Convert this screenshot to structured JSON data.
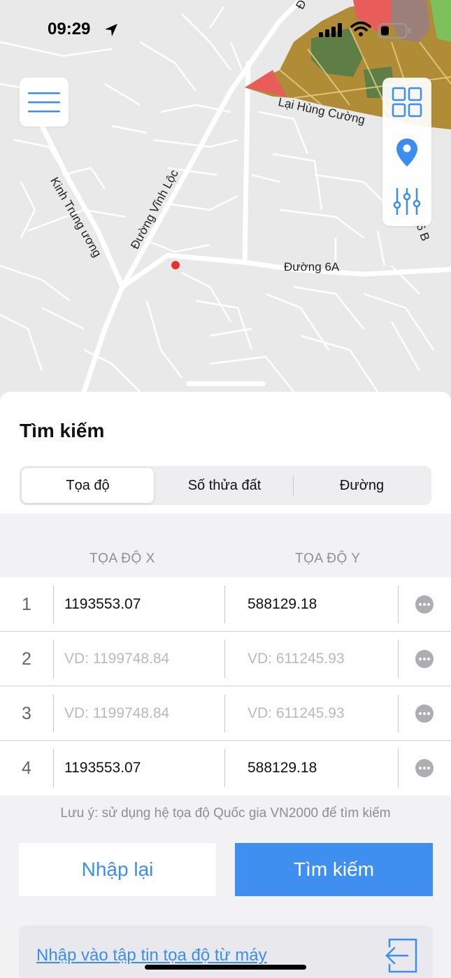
{
  "status_bar": {
    "time": "09:29"
  },
  "map": {
    "road_labels": [
      "Kinh Trung ương",
      "Đường Vĩnh Lộc",
      "Lại Hùng Cường",
      "Đường 6A",
      "6 B",
      "Đ"
    ],
    "colors": {
      "background": "#e9e9ea",
      "zone_ochre": "#b08c36",
      "zone_green": "#5f7e46",
      "zone_red": "#e85c5a",
      "marker": "#e8302a"
    }
  },
  "side_buttons": [
    "grid-icon",
    "location-pin-icon",
    "sliders-icon"
  ],
  "search": {
    "title": "Tìm kiếm",
    "tabs": [
      {
        "label": "Tọa độ",
        "active": true
      },
      {
        "label": "Số thửa đất",
        "active": false
      },
      {
        "label": "Đường",
        "active": false
      }
    ],
    "columns": {
      "x": "TỌA ĐỘ X",
      "y": "TỌA ĐỘ Y"
    },
    "rows": [
      {
        "index": "1",
        "x": "1193553.07",
        "y": "588129.18",
        "x_placeholder": "VD: 1199748.84",
        "y_placeholder": "VD: 611245.93"
      },
      {
        "index": "2",
        "x": "",
        "y": "",
        "x_placeholder": "VD: 1199748.84",
        "y_placeholder": "VD: 611245.93"
      },
      {
        "index": "3",
        "x": "",
        "y": "",
        "x_placeholder": "VD: 1199748.84",
        "y_placeholder": "VD: 611245.93"
      },
      {
        "index": "4",
        "x": "1193553.07",
        "y": "588129.18",
        "x_placeholder": "VD: 1199748.84",
        "y_placeholder": "VD: 611245.93"
      }
    ],
    "note": "Lưu ý: sử dụng hệ tọa độ Quốc gia VN2000 để tìm kiếm",
    "reset_label": "Nhập lại",
    "search_label": "Tìm kiếm",
    "import_label": "Nhập vào tập tin tọa độ từ máy",
    "accent": "#3f8ff0"
  }
}
